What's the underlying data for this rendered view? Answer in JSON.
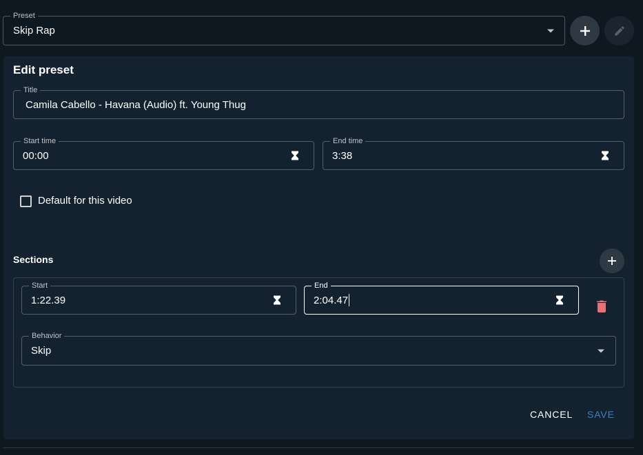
{
  "preset": {
    "label": "Preset",
    "value": "Skip Rap"
  },
  "edit": {
    "heading": "Edit preset",
    "title": {
      "label": "Title",
      "value": "Camila Cabello - Havana (Audio) ft. Young Thug"
    },
    "start_time": {
      "label": "Start time",
      "value": "00:00"
    },
    "end_time": {
      "label": "End time",
      "value": "3:38"
    },
    "default_checkbox": {
      "label": "Default for this video",
      "checked": false
    }
  },
  "sections": {
    "heading": "Sections",
    "items": [
      {
        "start": {
          "label": "Start",
          "value": "1:22.39"
        },
        "end": {
          "label": "End",
          "value": "2:04.47"
        },
        "behavior": {
          "label": "Behavior",
          "value": "Skip"
        }
      }
    ]
  },
  "actions": {
    "cancel": "CANCEL",
    "save": "SAVE"
  },
  "colors": {
    "page_bg": "#0e1821",
    "card_bg": "#142230",
    "save": "#3f7fbf",
    "delete": "#e57373"
  },
  "icons": [
    "chevron-down-icon",
    "plus-icon",
    "pencil-icon",
    "hourglass-icon",
    "trash-icon",
    "checkbox-icon"
  ]
}
